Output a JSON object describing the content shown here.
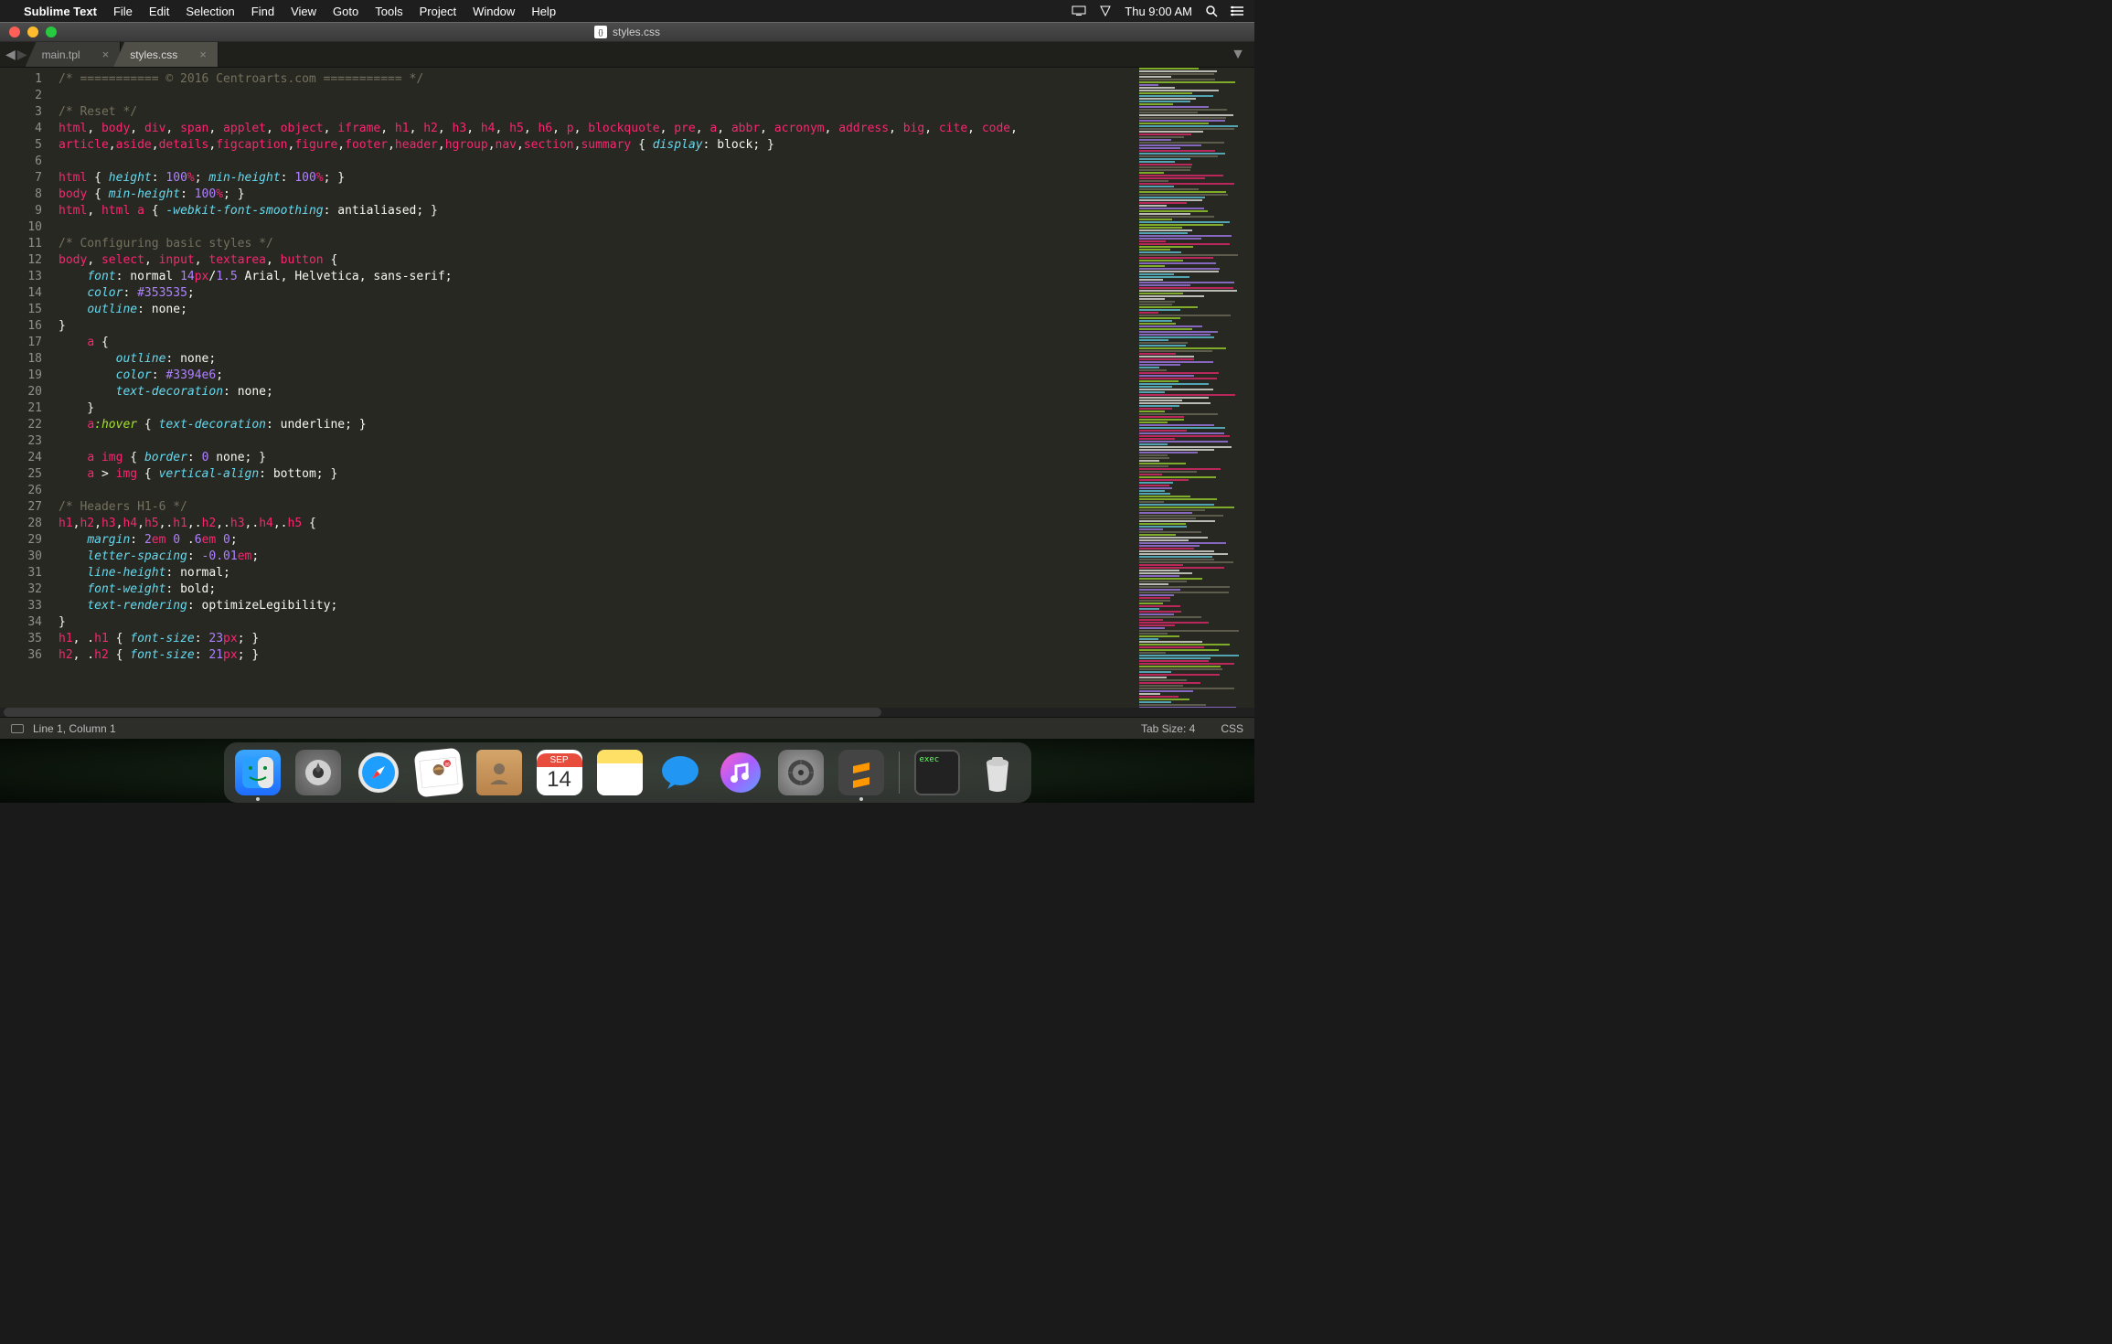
{
  "menubar": {
    "app": "Sublime Text",
    "items": [
      "File",
      "Edit",
      "Selection",
      "Find",
      "View",
      "Goto",
      "Tools",
      "Project",
      "Window",
      "Help"
    ],
    "clock": "Thu 9:00 AM"
  },
  "window": {
    "title": "styles.css"
  },
  "tabs": [
    {
      "label": "main.tpl",
      "active": false
    },
    {
      "label": "styles.css",
      "active": true
    }
  ],
  "gutter_start": 1,
  "gutter_end": 36,
  "code_lines": [
    [
      [
        "c-comment",
        "/* =========== © 2016 Centroarts.com =========== */"
      ]
    ],
    [],
    [
      [
        "c-comment",
        "/* Reset */"
      ]
    ],
    [
      [
        "c-tag",
        "html"
      ],
      [
        "c-punc",
        ", "
      ],
      [
        "c-tag",
        "body"
      ],
      [
        "c-punc",
        ", "
      ],
      [
        "c-tag",
        "div"
      ],
      [
        "c-punc",
        ", "
      ],
      [
        "c-tag",
        "span"
      ],
      [
        "c-punc",
        ", "
      ],
      [
        "c-tag",
        "applet"
      ],
      [
        "c-punc",
        ", "
      ],
      [
        "c-tag",
        "object"
      ],
      [
        "c-punc",
        ", "
      ],
      [
        "c-tag",
        "iframe"
      ],
      [
        "c-punc",
        ", "
      ],
      [
        "c-tag",
        "h1"
      ],
      [
        "c-punc",
        ", "
      ],
      [
        "c-tag",
        "h2"
      ],
      [
        "c-punc",
        ", "
      ],
      [
        "c-tag",
        "h3"
      ],
      [
        "c-punc",
        ", "
      ],
      [
        "c-tag",
        "h4"
      ],
      [
        "c-punc",
        ", "
      ],
      [
        "c-tag",
        "h5"
      ],
      [
        "c-punc",
        ", "
      ],
      [
        "c-tag",
        "h6"
      ],
      [
        "c-punc",
        ", "
      ],
      [
        "c-tag",
        "p"
      ],
      [
        "c-punc",
        ", "
      ],
      [
        "c-tag",
        "blockquote"
      ],
      [
        "c-punc",
        ", "
      ],
      [
        "c-tag",
        "pre"
      ],
      [
        "c-punc",
        ", "
      ],
      [
        "c-tag",
        "a"
      ],
      [
        "c-punc",
        ", "
      ],
      [
        "c-tag",
        "abbr"
      ],
      [
        "c-punc",
        ", "
      ],
      [
        "c-tag",
        "acronym"
      ],
      [
        "c-punc",
        ", "
      ],
      [
        "c-tag",
        "address"
      ],
      [
        "c-punc",
        ", "
      ],
      [
        "c-tag",
        "big"
      ],
      [
        "c-punc",
        ", "
      ],
      [
        "c-tag",
        "cite"
      ],
      [
        "c-punc",
        ", "
      ],
      [
        "c-tag",
        "code"
      ],
      [
        "c-punc",
        ", "
      ]
    ],
    [
      [
        "c-tag",
        "article"
      ],
      [
        "c-punc",
        ","
      ],
      [
        "c-tag",
        "aside"
      ],
      [
        "c-punc",
        ","
      ],
      [
        "c-tag",
        "details"
      ],
      [
        "c-punc",
        ","
      ],
      [
        "c-tag",
        "figcaption"
      ],
      [
        "c-punc",
        ","
      ],
      [
        "c-tag",
        "figure"
      ],
      [
        "c-punc",
        ","
      ],
      [
        "c-tag",
        "footer"
      ],
      [
        "c-punc",
        ","
      ],
      [
        "c-tag",
        "header"
      ],
      [
        "c-punc",
        ","
      ],
      [
        "c-tag",
        "hgroup"
      ],
      [
        "c-punc",
        ","
      ],
      [
        "c-tag",
        "nav"
      ],
      [
        "c-punc",
        ","
      ],
      [
        "c-tag",
        "section"
      ],
      [
        "c-punc",
        ","
      ],
      [
        "c-tag",
        "summary"
      ],
      [
        "c-punc",
        " { "
      ],
      [
        "c-prop",
        "display"
      ],
      [
        "c-punc",
        ": "
      ],
      [
        "c-val",
        "block"
      ],
      [
        "c-punc",
        "; }"
      ]
    ],
    [],
    [
      [
        "c-tag",
        "html"
      ],
      [
        "c-punc",
        " { "
      ],
      [
        "c-prop",
        "height"
      ],
      [
        "c-punc",
        ": "
      ],
      [
        "c-num",
        "100"
      ],
      [
        "c-unit",
        "%"
      ],
      [
        "c-punc",
        "; "
      ],
      [
        "c-prop",
        "min-height"
      ],
      [
        "c-punc",
        ": "
      ],
      [
        "c-num",
        "100"
      ],
      [
        "c-unit",
        "%"
      ],
      [
        "c-punc",
        "; }"
      ]
    ],
    [
      [
        "c-tag",
        "body"
      ],
      [
        "c-punc",
        " { "
      ],
      [
        "c-prop",
        "min-height"
      ],
      [
        "c-punc",
        ": "
      ],
      [
        "c-num",
        "100"
      ],
      [
        "c-unit",
        "%"
      ],
      [
        "c-punc",
        "; }"
      ]
    ],
    [
      [
        "c-tag",
        "html"
      ],
      [
        "c-punc",
        ", "
      ],
      [
        "c-tag",
        "html"
      ],
      [
        "c-punc",
        " "
      ],
      [
        "c-tag",
        "a"
      ],
      [
        "c-punc",
        " { "
      ],
      [
        "c-prop",
        "-webkit-font-smoothing"
      ],
      [
        "c-punc",
        ": "
      ],
      [
        "c-val",
        "antialiased"
      ],
      [
        "c-punc",
        "; }"
      ]
    ],
    [],
    [
      [
        "c-comment",
        "/* Configuring basic styles */"
      ]
    ],
    [
      [
        "c-tag",
        "body"
      ],
      [
        "c-punc",
        ", "
      ],
      [
        "c-tag",
        "select"
      ],
      [
        "c-punc",
        ", "
      ],
      [
        "c-tag",
        "input"
      ],
      [
        "c-punc",
        ", "
      ],
      [
        "c-tag",
        "textarea"
      ],
      [
        "c-punc",
        ", "
      ],
      [
        "c-tag",
        "button"
      ],
      [
        "c-punc",
        " {"
      ]
    ],
    [
      [
        "c-punc",
        "    "
      ],
      [
        "c-prop",
        "font"
      ],
      [
        "c-punc",
        ": "
      ],
      [
        "c-val",
        "normal "
      ],
      [
        "c-num",
        "14"
      ],
      [
        "c-unit",
        "px"
      ],
      [
        "c-punc",
        "/"
      ],
      [
        "c-num",
        "1.5"
      ],
      [
        "c-val",
        " Arial, Helvetica, sans-serif"
      ],
      [
        "c-punc",
        ";"
      ]
    ],
    [
      [
        "c-punc",
        "    "
      ],
      [
        "c-prop",
        "color"
      ],
      [
        "c-punc",
        ": "
      ],
      [
        "c-hex",
        "#353535"
      ],
      [
        "c-punc",
        ";"
      ]
    ],
    [
      [
        "c-punc",
        "    "
      ],
      [
        "c-prop",
        "outline"
      ],
      [
        "c-punc",
        ": "
      ],
      [
        "c-val",
        "none"
      ],
      [
        "c-punc",
        ";"
      ]
    ],
    [
      [
        "c-punc",
        "}"
      ]
    ],
    [
      [
        "c-punc",
        "    "
      ],
      [
        "c-tag",
        "a"
      ],
      [
        "c-punc",
        " {"
      ]
    ],
    [
      [
        "c-punc",
        "        "
      ],
      [
        "c-prop",
        "outline"
      ],
      [
        "c-punc",
        ": "
      ],
      [
        "c-val",
        "none"
      ],
      [
        "c-punc",
        ";"
      ]
    ],
    [
      [
        "c-punc",
        "        "
      ],
      [
        "c-prop",
        "color"
      ],
      [
        "c-punc",
        ": "
      ],
      [
        "c-hex",
        "#3394e6"
      ],
      [
        "c-punc",
        ";"
      ]
    ],
    [
      [
        "c-punc",
        "        "
      ],
      [
        "c-prop",
        "text-decoration"
      ],
      [
        "c-punc",
        ": "
      ],
      [
        "c-val",
        "none"
      ],
      [
        "c-punc",
        ";"
      ]
    ],
    [
      [
        "c-punc",
        "    }"
      ]
    ],
    [
      [
        "c-punc",
        "    "
      ],
      [
        "c-tag",
        "a"
      ],
      [
        "c-pseudo",
        ":hover"
      ],
      [
        "c-punc",
        " { "
      ],
      [
        "c-prop",
        "text-decoration"
      ],
      [
        "c-punc",
        ": "
      ],
      [
        "c-val",
        "underline"
      ],
      [
        "c-punc",
        "; }"
      ]
    ],
    [],
    [
      [
        "c-punc",
        "    "
      ],
      [
        "c-tag",
        "a"
      ],
      [
        "c-punc",
        " "
      ],
      [
        "c-tag",
        "img"
      ],
      [
        "c-punc",
        " { "
      ],
      [
        "c-prop",
        "border"
      ],
      [
        "c-punc",
        ": "
      ],
      [
        "c-num",
        "0"
      ],
      [
        "c-val",
        " none"
      ],
      [
        "c-punc",
        "; }"
      ]
    ],
    [
      [
        "c-punc",
        "    "
      ],
      [
        "c-tag",
        "a"
      ],
      [
        "c-punc",
        " > "
      ],
      [
        "c-tag",
        "img"
      ],
      [
        "c-punc",
        " { "
      ],
      [
        "c-prop",
        "vertical-align"
      ],
      [
        "c-punc",
        ": "
      ],
      [
        "c-val",
        "bottom"
      ],
      [
        "c-punc",
        "; }"
      ]
    ],
    [],
    [
      [
        "c-comment",
        "/* Headers H1-6 */"
      ]
    ],
    [
      [
        "c-tag",
        "h1"
      ],
      [
        "c-punc",
        ","
      ],
      [
        "c-tag",
        "h2"
      ],
      [
        "c-punc",
        ","
      ],
      [
        "c-tag",
        "h3"
      ],
      [
        "c-punc",
        ","
      ],
      [
        "c-tag",
        "h4"
      ],
      [
        "c-punc",
        ","
      ],
      [
        "c-tag",
        "h5"
      ],
      [
        "c-punc",
        ",."
      ],
      [
        "c-tag",
        "h1"
      ],
      [
        "c-punc",
        ",."
      ],
      [
        "c-tag",
        "h2"
      ],
      [
        "c-punc",
        ",."
      ],
      [
        "c-tag",
        "h3"
      ],
      [
        "c-punc",
        ",."
      ],
      [
        "c-tag",
        "h4"
      ],
      [
        "c-punc",
        ",."
      ],
      [
        "c-tag",
        "h5"
      ],
      [
        "c-punc",
        " {"
      ]
    ],
    [
      [
        "c-punc",
        "    "
      ],
      [
        "c-prop",
        "margin"
      ],
      [
        "c-punc",
        ": "
      ],
      [
        "c-num",
        "2"
      ],
      [
        "c-unit",
        "em"
      ],
      [
        "c-punc",
        " "
      ],
      [
        "c-num",
        "0"
      ],
      [
        "c-punc",
        " ."
      ],
      [
        "c-num",
        "6"
      ],
      [
        "c-unit",
        "em"
      ],
      [
        "c-punc",
        " "
      ],
      [
        "c-num",
        "0"
      ],
      [
        "c-punc",
        ";"
      ]
    ],
    [
      [
        "c-punc",
        "    "
      ],
      [
        "c-prop",
        "letter-spacing"
      ],
      [
        "c-punc",
        ": "
      ],
      [
        "c-num",
        "-0.01"
      ],
      [
        "c-unit",
        "em"
      ],
      [
        "c-punc",
        ";"
      ]
    ],
    [
      [
        "c-punc",
        "    "
      ],
      [
        "c-prop",
        "line-height"
      ],
      [
        "c-punc",
        ": "
      ],
      [
        "c-val",
        "normal"
      ],
      [
        "c-punc",
        ";"
      ]
    ],
    [
      [
        "c-punc",
        "    "
      ],
      [
        "c-prop",
        "font-weight"
      ],
      [
        "c-punc",
        ": "
      ],
      [
        "c-val",
        "bold"
      ],
      [
        "c-punc",
        ";"
      ]
    ],
    [
      [
        "c-punc",
        "    "
      ],
      [
        "c-prop",
        "text-rendering"
      ],
      [
        "c-punc",
        ": "
      ],
      [
        "c-val",
        "optimizeLegibility"
      ],
      [
        "c-punc",
        ";"
      ]
    ],
    [
      [
        "c-punc",
        "}"
      ]
    ],
    [
      [
        "c-tag",
        "h1"
      ],
      [
        "c-punc",
        ", ."
      ],
      [
        "c-tag",
        "h1"
      ],
      [
        "c-punc",
        " { "
      ],
      [
        "c-prop",
        "font-size"
      ],
      [
        "c-punc",
        ": "
      ],
      [
        "c-num",
        "23"
      ],
      [
        "c-unit",
        "px"
      ],
      [
        "c-punc",
        "; }"
      ]
    ],
    [
      [
        "c-tag",
        "h2"
      ],
      [
        "c-punc",
        ", ."
      ],
      [
        "c-tag",
        "h2"
      ],
      [
        "c-punc",
        " { "
      ],
      [
        "c-prop",
        "font-size"
      ],
      [
        "c-punc",
        ": "
      ],
      [
        "c-num",
        "21"
      ],
      [
        "c-unit",
        "px"
      ],
      [
        "c-punc",
        "; }"
      ]
    ]
  ],
  "statusbar": {
    "cursor": "Line 1, Column 1",
    "tabsize": "Tab Size: 4",
    "syntax": "CSS"
  },
  "dock": {
    "apps": [
      "finder",
      "launchpad",
      "safari",
      "mail",
      "contacts",
      "calendar",
      "notes",
      "messages",
      "itunes",
      "settings",
      "sublime"
    ],
    "calendar_month": "SEP",
    "calendar_day": "14",
    "terminal_label": "exec",
    "right": [
      "terminal",
      "trash"
    ]
  }
}
